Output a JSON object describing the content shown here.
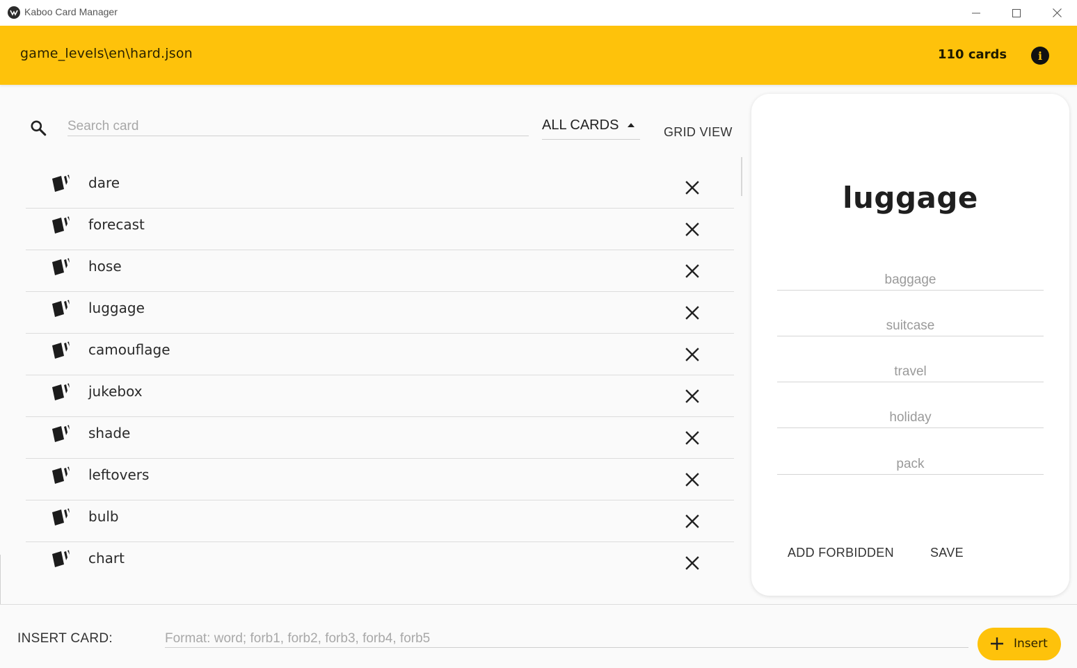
{
  "window": {
    "title": "Kaboo Card Manager",
    "icon": "kaboo-logo-icon",
    "controls": [
      "minimize-icon",
      "maximize-icon",
      "close-icon"
    ]
  },
  "header": {
    "file_path": "game_levels\\en\\hard.json",
    "card_count": "110 cards",
    "info_icon": "info-icon",
    "background_color": "#fec20b"
  },
  "search": {
    "placeholder": "Search card",
    "value": "",
    "icon": "search-icon"
  },
  "filter": {
    "selected": "ALL CARDS"
  },
  "view_toggle": {
    "label": "GRID VIEW"
  },
  "cards": [
    {
      "word": "dare"
    },
    {
      "word": "forecast"
    },
    {
      "word": "hose"
    },
    {
      "word": "luggage"
    },
    {
      "word": "camouflage"
    },
    {
      "word": "jukebox"
    },
    {
      "word": "shade"
    },
    {
      "word": "leftovers"
    },
    {
      "word": "bulb"
    },
    {
      "word": "chart"
    }
  ],
  "detail": {
    "word": "luggage",
    "forbidden": [
      "baggage",
      "suitcase",
      "travel",
      "holiday",
      "pack"
    ],
    "add_forbidden_label": "ADD FORBIDDEN",
    "save_label": "SAVE"
  },
  "insert": {
    "label": "INSERT CARD:",
    "placeholder": "Format: word; forb1, forb2, forb3, forb4, forb5",
    "button_label": "Insert",
    "button_icon": "plus-icon"
  }
}
